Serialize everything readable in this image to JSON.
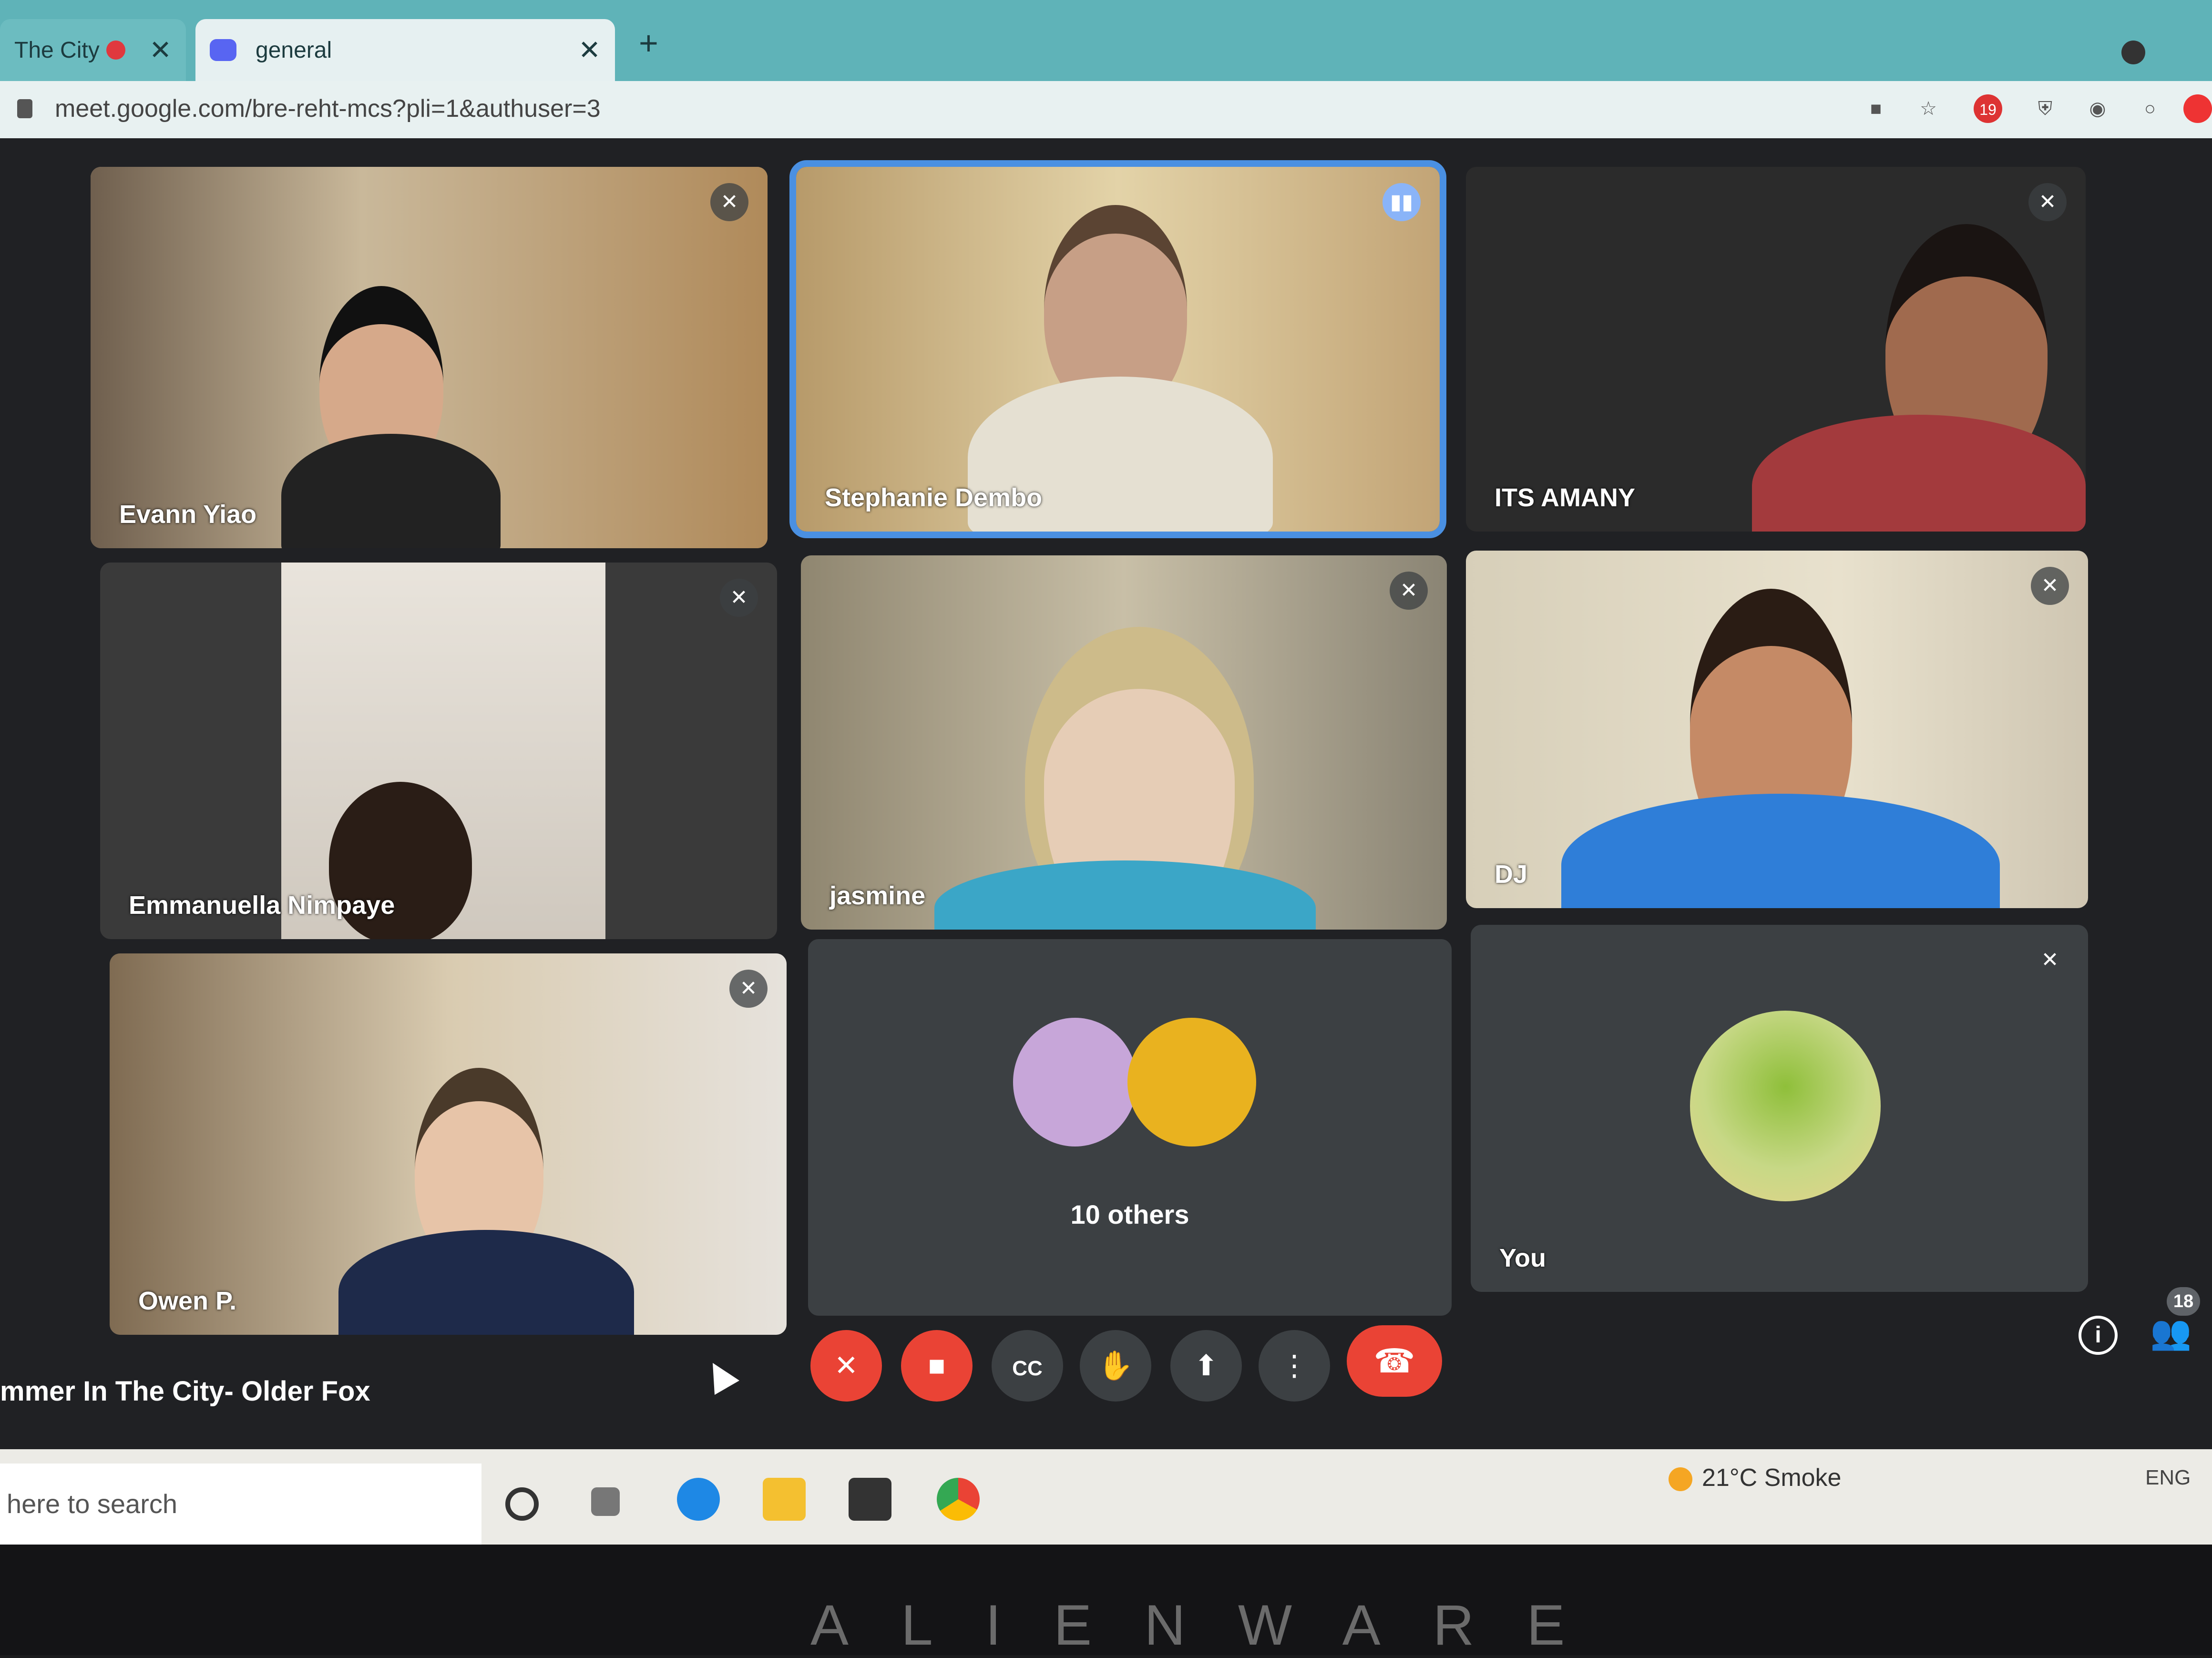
{
  "browser": {
    "tabs": [
      {
        "title": "The City",
        "recording": true
      },
      {
        "title": "general"
      }
    ],
    "new_tab": "+",
    "url": "meet.google.com/bre-reht-mcs?pli=1&authuser=3",
    "extension_badge": "19"
  },
  "participants": [
    {
      "name": "Evann Yiao",
      "muted": true
    },
    {
      "name": "Stephanie Dembo",
      "speaking": true
    },
    {
      "name": "ITS AMANY",
      "muted": true
    },
    {
      "name": "Emmanuella Nimpaye",
      "muted": true
    },
    {
      "name": "jasmine",
      "muted": true
    },
    {
      "name": "DJ",
      "muted": true
    },
    {
      "name": "Owen P.",
      "muted": true
    },
    {
      "name": "10 others"
    },
    {
      "name": "You",
      "muted": true
    }
  ],
  "meeting": {
    "name": "mmer In The City- Older Fox",
    "participant_count": "18"
  },
  "controls": {
    "mic_icon": "mic-off-icon",
    "camera_icon": "camera-off-icon",
    "captions_label": "CC",
    "hand_icon": "hand-icon",
    "present_icon": "present-icon",
    "more_icon": "more-vert-icon",
    "end_icon": "end-call-icon"
  },
  "taskbar": {
    "search_placeholder": "here to search",
    "weather": "21°C  Smoke",
    "language": "ENG"
  },
  "laptop_brand": "ALIENWARE",
  "colors": {
    "accent_blue": "#4a90e2",
    "danger_red": "#ea4335",
    "tile_bg": "#3c4043"
  }
}
